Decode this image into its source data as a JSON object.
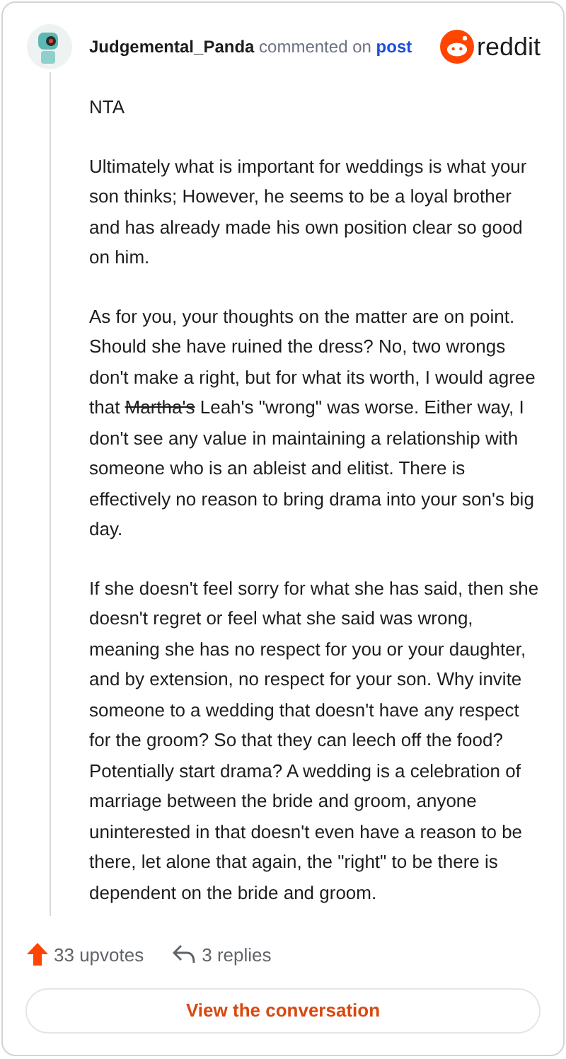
{
  "author": {
    "name": "Judgemental_Panda",
    "action": "commented on",
    "link": "post"
  },
  "brand": {
    "name": "reddit"
  },
  "paragraphs": [
    {
      "parts": [
        {
          "text": "NTA",
          "struck": false
        }
      ]
    },
    {
      "parts": [
        {
          "text": "Ultimately what is important for weddings is what your son thinks; However, he seems to be a loyal brother and has already made his own position clear so good on him.",
          "struck": false
        }
      ]
    },
    {
      "parts": [
        {
          "text": "As for you, your thoughts on the matter are on point. Should she have ruined the dress? No, two wrongs don't make a right, but for what its worth, I would agree that ",
          "struck": false
        },
        {
          "text": "Martha's",
          "struck": true
        },
        {
          "text": " Leah's \"wrong\" was worse. Either way, I don't see any value in maintaining a relationship with someone who is an ableist and elitist. There is effectively no reason to bring drama into your son's big day.",
          "struck": false
        }
      ]
    },
    {
      "parts": [
        {
          "text": "If she doesn't feel sorry for what she has said, then she doesn't regret or feel what she said was wrong, meaning she has no respect for you or your daughter, and by extension, no respect for your son. Why invite someone to a wedding that doesn't have any respect for the groom? So that they can leech off the food? Potentially start drama? A wedding is a celebration of marriage between the bride and groom, anyone uninterested in that doesn't even have a reason to be there, let alone that again, the \"right\" to be there is dependent on the bride and groom.",
          "struck": false
        }
      ]
    }
  ],
  "stats": {
    "upvotes": "33 upvotes",
    "replies": "3 replies"
  },
  "button": "View the conversation"
}
